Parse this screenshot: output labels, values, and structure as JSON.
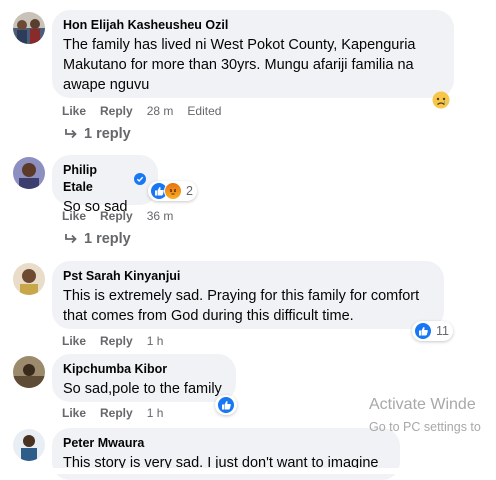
{
  "comments": [
    {
      "author": "Hon Elijah Kasheusheu Ozil",
      "text": "The family has lived ni West Pokot County, Kapenguria Makutano for more than 30yrs. Mungu afariji familia na awape nguvu",
      "like": "Like",
      "reply": "Reply",
      "time": "28 m",
      "edited": "Edited",
      "replies": "1 reply",
      "reaction_icon": "sad-emoji-icon"
    },
    {
      "author": "Philip Etale",
      "verified": true,
      "text": "So so sad",
      "like": "Like",
      "reply": "Reply",
      "time": "36 m",
      "replies": "1 reply",
      "reaction_count": "2"
    },
    {
      "author": "Pst Sarah Kinyanjui",
      "text": "This is extremely sad. Praying for this family for comfort that comes from God during this difficult time.",
      "like": "Like",
      "reply": "Reply",
      "time": "1 h",
      "reaction_count": "11"
    },
    {
      "author": "Kipchumba Kibor",
      "text": "So sad,pole to the family",
      "like": "Like",
      "reply": "Reply",
      "time": "1 h"
    },
    {
      "author": "Peter Mwaura",
      "text": "This story is very sad. I just don't want to imagine"
    }
  ],
  "watermark": {
    "title": "Activate Winde",
    "subtitle": "Go to PC settings to"
  },
  "colors": {
    "bubble": "#f0f2f5",
    "secondary_text": "#65676b",
    "like_blue": "#1877f2",
    "angry_orange": "#e9710f"
  }
}
